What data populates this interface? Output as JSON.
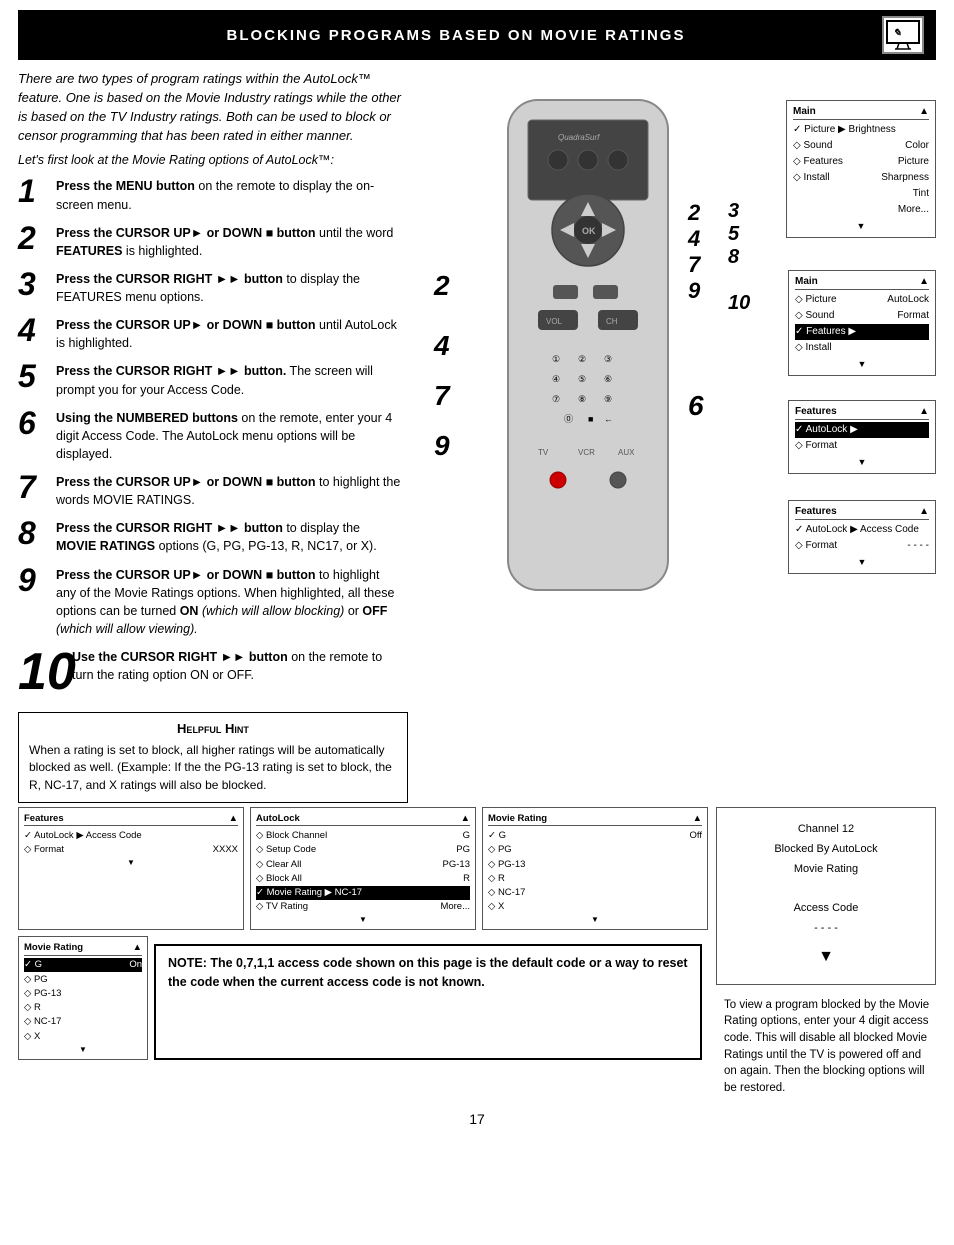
{
  "header": {
    "title": "Blocking Programs Based on Movie Ratings",
    "icon": "📺"
  },
  "intro": {
    "paragraph": "There are two types of program ratings within the AutoLock™ feature. One is based on the Movie Industry ratings while the other is based on the TV Industry ratings. Both can be used to block or censor programming that has been rated in either manner.",
    "sub": "Let's first look at the Movie Rating options of AutoLock™:"
  },
  "steps": [
    {
      "num": "1",
      "large": false,
      "text": "Press the MENU button on the remote to display the on-screen menu."
    },
    {
      "num": "2",
      "large": false,
      "text": "Press the CURSOR UP▶ or DOWN ■ button until the word FEATURES is highlighted."
    },
    {
      "num": "3",
      "large": false,
      "text": "Press the CURSOR RIGHT▶▶ button to display the FEATURES menu options."
    },
    {
      "num": "4",
      "large": false,
      "text": "Press the CURSOR UP▶ or DOWN ■ button until AutoLock is highlighted."
    },
    {
      "num": "5",
      "large": false,
      "text": "Press the CURSOR RIGHT▶▶ button. The screen will prompt you for your Access Code."
    },
    {
      "num": "6",
      "large": false,
      "text": "Using the NUMBERED buttons on the remote, enter your 4 digit Access Code. The AutoLock menu options will be displayed."
    },
    {
      "num": "7",
      "large": false,
      "text": "Press the CURSOR UP▶ or DOWN ■ button to highlight the words MOVIE RATINGS."
    },
    {
      "num": "8",
      "large": false,
      "text": "Press the CURSOR RIGHT▶▶ button to display the MOVIE RATINGS options (G, PG, PG-13, R, NC17, or X)."
    },
    {
      "num": "9",
      "large": false,
      "text": "Press the CURSOR UP▶ or DOWN ■ button to highlight any of the Movie Ratings options. When highlighted, all these options can be turned ON (which will allow blocking) or OFF (which will allow viewing)."
    },
    {
      "num": "10",
      "large": true,
      "text": "Use the CURSOR RIGHT▶▶ button on the remote to turn the rating option ON or OFF."
    }
  ],
  "hint": {
    "title": "Helpful Hint",
    "text": "When a rating is set to block, all higher ratings will be automatically blocked as well. (Example: If the the PG-13 rating is set to block, the R, NC-17, and X ratings will also be blocked."
  },
  "panels": {
    "panel1": {
      "header_left": "Main",
      "header_right": "▲",
      "rows": [
        {
          "label": "✓ Picture",
          "value": "▶ Brightness",
          "highlighted": false
        },
        {
          "label": "◇ Sound",
          "value": "Color",
          "highlighted": false
        },
        {
          "label": "◇ Features",
          "value": "Picture",
          "highlighted": false
        },
        {
          "label": "◇ Install",
          "value": "Sharpness",
          "highlighted": false
        },
        {
          "label": "",
          "value": "Tint",
          "highlighted": false
        },
        {
          "label": "",
          "value": "More...",
          "highlighted": false
        }
      ]
    },
    "panel2": {
      "header_left": "Main",
      "header_right": "▲",
      "rows": [
        {
          "label": "◇ Picture",
          "value": "AutoLock",
          "highlighted": false
        },
        {
          "label": "◇ Sound",
          "value": "Format",
          "highlighted": false
        },
        {
          "label": "✓ Features",
          "value": "▶",
          "highlighted": true
        },
        {
          "label": "◇ Install",
          "value": "",
          "highlighted": false
        }
      ]
    },
    "panel3": {
      "header_left": "Features",
      "header_right": "▲",
      "rows": [
        {
          "label": "✓ AutoLock",
          "value": "▶",
          "highlighted": true
        },
        {
          "label": "◇ Format",
          "value": "",
          "highlighted": false
        }
      ]
    },
    "panel4": {
      "header_left": "Features",
      "header_right": "▲",
      "rows": [
        {
          "label": "✓ AutoLock",
          "value": "▶ Access Code",
          "highlighted": false
        },
        {
          "label": "◇ Format",
          "value": "- - - -",
          "highlighted": false
        }
      ]
    },
    "panel5": {
      "header_left": "AutoLock",
      "header_right": "▲",
      "rows": [
        {
          "label": "◇ Block Channel",
          "value": "G",
          "highlighted": false
        },
        {
          "label": "◇ Setup Code",
          "value": "PG",
          "highlighted": false
        },
        {
          "label": "◇ Clear All",
          "value": "PG-13",
          "highlighted": false
        },
        {
          "label": "◇ Block All",
          "value": "R",
          "highlighted": false
        },
        {
          "label": "✓ Movie Rating",
          "value": "▶ NC-17",
          "highlighted": true
        },
        {
          "label": "◇ TV Rating",
          "value": "More...",
          "highlighted": false
        }
      ]
    },
    "panel6": {
      "header_left": "Movie Rating",
      "header_right": "▲",
      "rows": [
        {
          "label": "✓ G",
          "value": "Off",
          "highlighted": false
        },
        {
          "label": "◇ PG",
          "value": "",
          "highlighted": false
        },
        {
          "label": "◇ PG-13",
          "value": "",
          "highlighted": false
        },
        {
          "label": "◇ R",
          "value": "",
          "highlighted": false
        },
        {
          "label": "◇ NC-17",
          "value": "",
          "highlighted": false
        },
        {
          "label": "◇ X",
          "value": "",
          "highlighted": false
        }
      ]
    },
    "panel_access": {
      "header_left": "Features",
      "header_right": "▲",
      "rows": [
        {
          "label": "✓ AutoLock",
          "value": "▶ Access Code",
          "highlighted": false
        },
        {
          "label": "◇ Format",
          "value": "XXXX",
          "highlighted": false
        }
      ]
    },
    "panel_movie_on": {
      "header_left": "Movie Rating",
      "header_right": "▲",
      "rows": [
        {
          "label": "✓ G",
          "value": "On",
          "highlighted": true
        },
        {
          "label": "◇ PG",
          "value": "",
          "highlighted": false
        },
        {
          "label": "◇ PG-13",
          "value": "",
          "highlighted": false
        },
        {
          "label": "◇ R",
          "value": "",
          "highlighted": false
        },
        {
          "label": "◇ NC-17",
          "value": "",
          "highlighted": false
        },
        {
          "label": "◇ X",
          "value": "",
          "highlighted": false
        }
      ]
    }
  },
  "note": {
    "text": "NOTE: The 0,7,1,1 access code shown on this page is the default code or a way to reset the code when the current access code is not known."
  },
  "side_note": {
    "text": "To view a program blocked by the Movie Rating options, enter your 4 digit access code. This will disable all blocked Movie Ratings until the TV is powered off and on again. Then the blocking options will be restored."
  },
  "channel_blocked": {
    "line1": "Channel 12",
    "line2": "Blocked By AutoLock",
    "line3": "Movie Rating",
    "line4": "Access Code",
    "line5": "- - - -"
  },
  "page_number": "17"
}
